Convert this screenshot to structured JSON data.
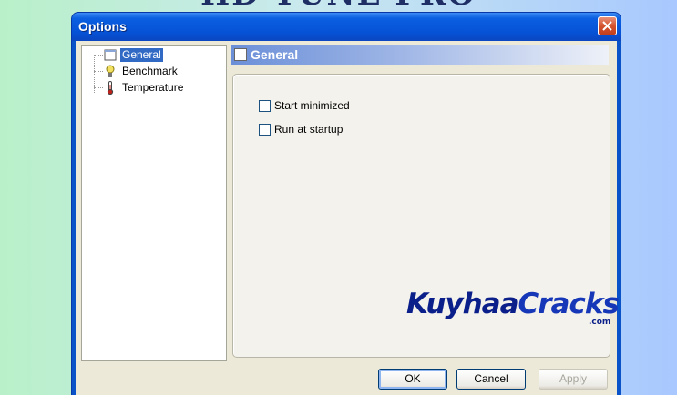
{
  "banner": {
    "title": "HD TUNE PRO"
  },
  "window": {
    "title": "Options",
    "close_icon": "close-icon"
  },
  "tree": {
    "items": [
      {
        "label": "General",
        "icon": "general-icon",
        "selected": true
      },
      {
        "label": "Benchmark",
        "icon": "benchmark-icon",
        "selected": false
      },
      {
        "label": "Temperature",
        "icon": "thermometer-icon",
        "selected": false
      }
    ]
  },
  "page": {
    "header": "General",
    "options": [
      {
        "label": "Start minimized",
        "checked": false
      },
      {
        "label": "Run at startup",
        "checked": false
      }
    ]
  },
  "buttons": {
    "ok": "OK",
    "cancel": "Cancel",
    "apply": "Apply"
  },
  "watermark": {
    "part1": "Kuyhaa",
    "part2": "Cracks",
    "suffix": ".com"
  },
  "colors": {
    "titlebar": "#0652d6",
    "selection": "#316ac5",
    "close_button": "#d4532f"
  }
}
